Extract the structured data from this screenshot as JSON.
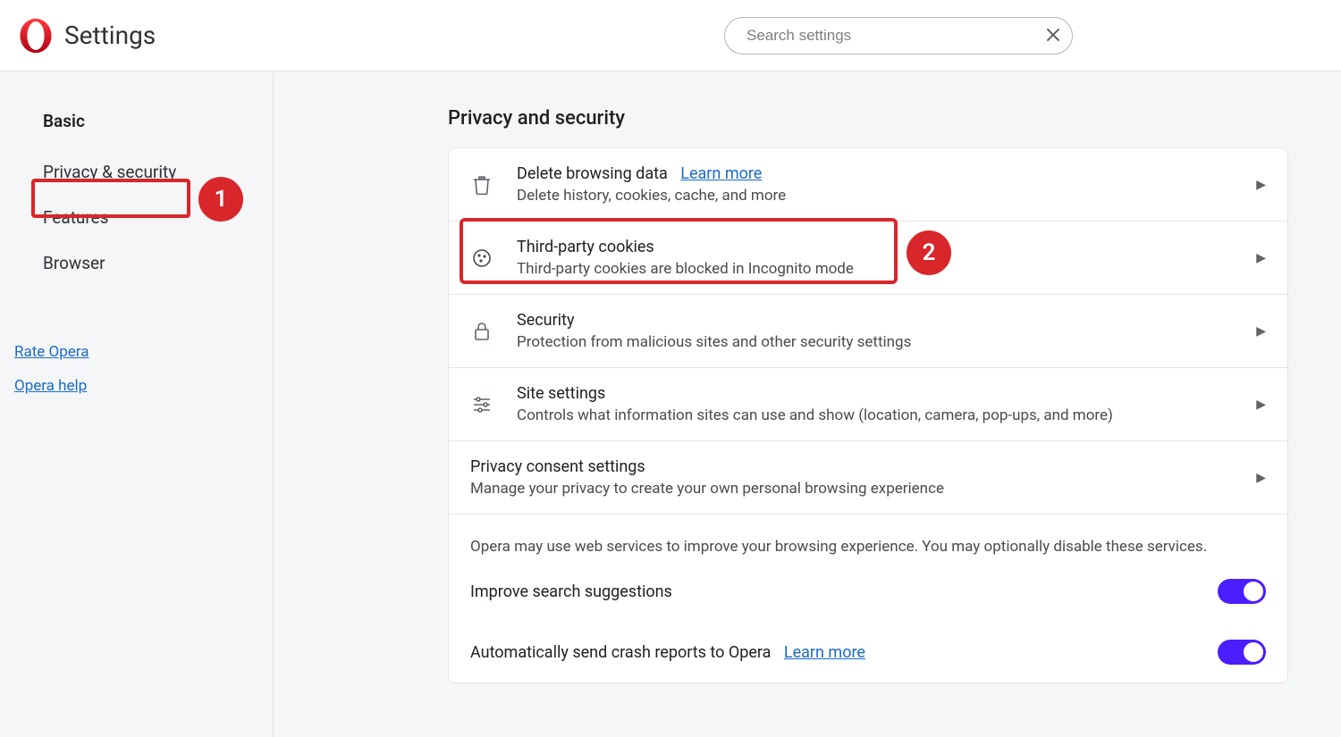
{
  "header": {
    "title": "Settings",
    "search_placeholder": "Search settings"
  },
  "sidebar": {
    "heading": "Basic",
    "items": [
      {
        "label": "Privacy & security"
      },
      {
        "label": "Features"
      },
      {
        "label": "Browser"
      }
    ],
    "links": [
      {
        "label": "Rate Opera"
      },
      {
        "label": "Opera help"
      }
    ]
  },
  "annotations": {
    "badge1": "1",
    "badge2": "2"
  },
  "main": {
    "section_title": "Privacy and security",
    "rows": [
      {
        "title": "Delete browsing data",
        "learn_more": "Learn more",
        "sub": "Delete history, cookies, cache, and more"
      },
      {
        "title": "Third-party cookies",
        "sub": "Third-party cookies are blocked in Incognito mode"
      },
      {
        "title": "Security",
        "sub": "Protection from malicious sites and other security settings"
      },
      {
        "title": "Site settings",
        "sub": "Controls what information sites can use and show (location, camera, pop-ups, and more)"
      },
      {
        "title": "Privacy consent settings",
        "sub": "Manage your privacy to create your own personal browsing experience"
      }
    ],
    "info_text": "Opera may use web services to improve your browsing experience. You may optionally disable these services.",
    "toggles": [
      {
        "label": "Improve search suggestions"
      },
      {
        "label": "Automatically send crash reports to Opera",
        "learn_more": "Learn more"
      }
    ]
  }
}
